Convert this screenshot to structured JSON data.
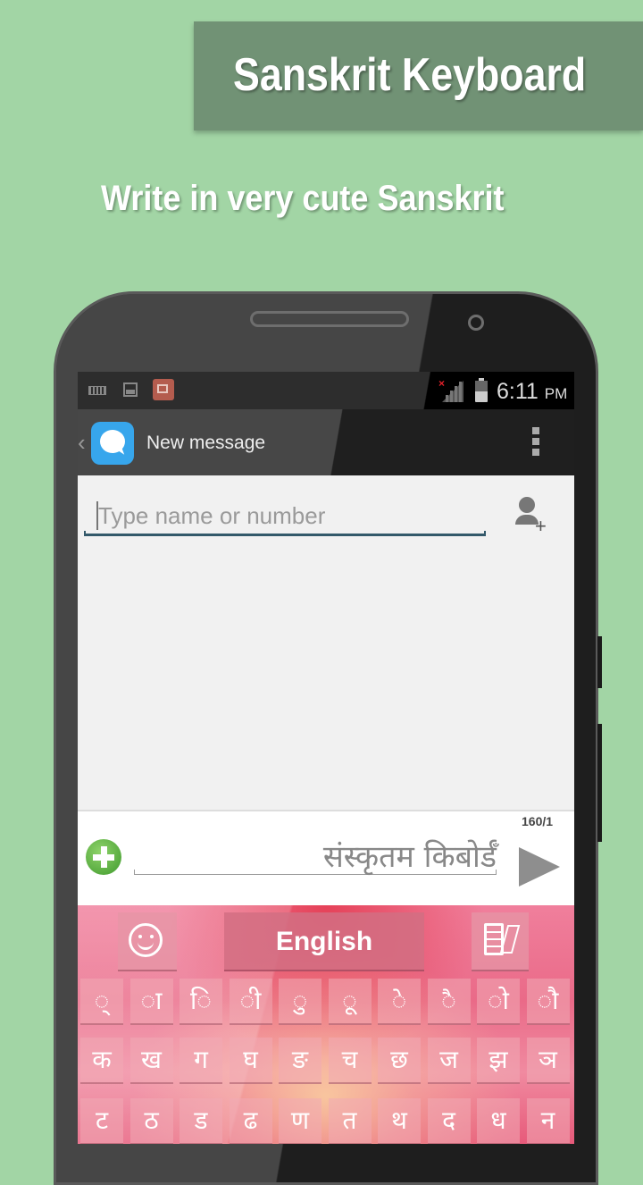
{
  "promo": {
    "title": "Sanskrit Keyboard",
    "subtitle": "Write in very cute Sanskrit"
  },
  "status_bar": {
    "icons": [
      "keyboard-icon",
      "image-icon",
      "video-icon"
    ],
    "signal": "no-signal",
    "time": "6:11",
    "ampm": "PM"
  },
  "action_bar": {
    "back": "‹",
    "title": "New message",
    "menu_icon": "overflow-menu-icon"
  },
  "recipient": {
    "placeholder": "Type name or number",
    "value": ""
  },
  "compose": {
    "counter": "160/1",
    "message": "संस्कृतम किबोर्डँ"
  },
  "keyboard": {
    "language_label": "English",
    "matra_row": [
      "्",
      "ा",
      "ि",
      "ी",
      "ु",
      "ू",
      "े",
      "ै",
      "ो",
      "ौ"
    ],
    "consonant_row_1": [
      "क",
      "ख",
      "ग",
      "घ",
      "ङ",
      "च",
      "छ",
      "ज",
      "झ",
      "ञ"
    ],
    "consonant_row_2": [
      "ट",
      "ठ",
      "ड",
      "ढ",
      "ण",
      "त",
      "थ",
      "द",
      "ध",
      "न"
    ]
  }
}
